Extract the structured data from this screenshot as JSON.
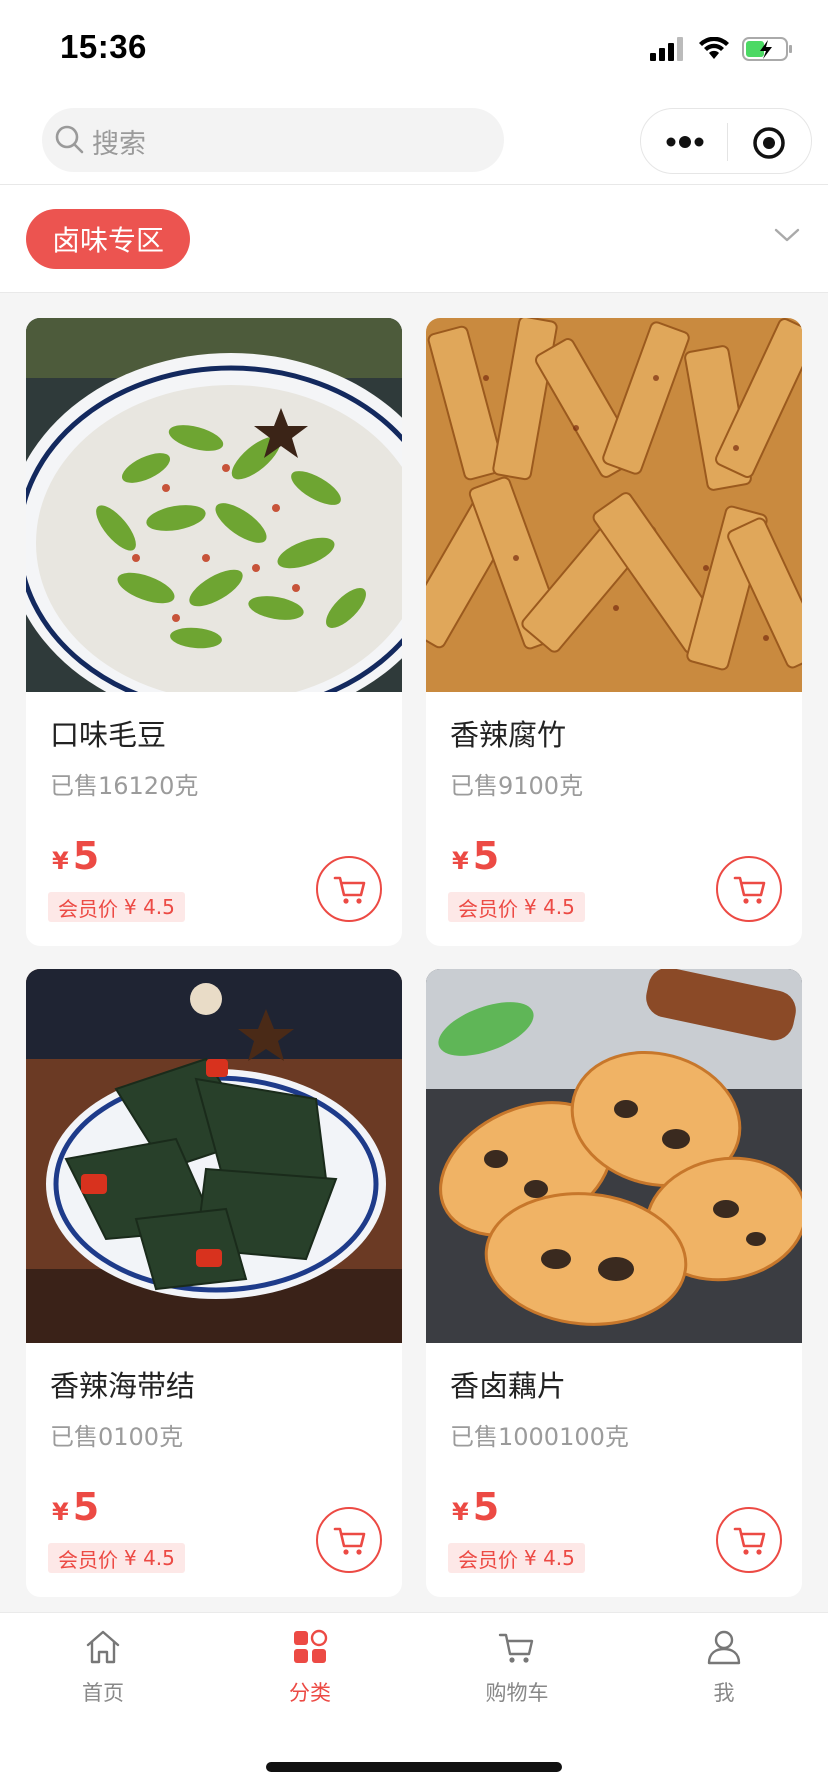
{
  "status_bar": {
    "time": "15:36"
  },
  "search": {
    "placeholder": "搜索"
  },
  "category": {
    "selected": "卤味专区"
  },
  "currency_symbol": "¥",
  "member_price_label": "会员价",
  "products": [
    {
      "name": "口味毛豆",
      "sold": "已售16120克",
      "price": "5",
      "member_price": "¥ 4.5",
      "image": "edamame-icon"
    },
    {
      "name": "香辣腐竹",
      "sold": "已售9100克",
      "price": "5",
      "member_price": "¥ 4.5",
      "image": "tofu-skin-icon"
    },
    {
      "name": "香辣海带结",
      "sold": "已售0100克",
      "price": "5",
      "member_price": "¥ 4.5",
      "image": "kelp-icon"
    },
    {
      "name": "香卤藕片",
      "sold": "已售1000100克",
      "price": "5",
      "member_price": "¥ 4.5",
      "image": "lotus-root-icon"
    }
  ],
  "tabs": [
    {
      "label": "首页",
      "icon": "home-icon"
    },
    {
      "label": "分类",
      "icon": "category-icon",
      "active": true
    },
    {
      "label": "购物车",
      "icon": "cart-icon"
    },
    {
      "label": "我",
      "icon": "user-icon"
    }
  ],
  "colors": {
    "accent": "#ec4a44",
    "pill": "#ec5450",
    "background": "#f5f5f5"
  }
}
